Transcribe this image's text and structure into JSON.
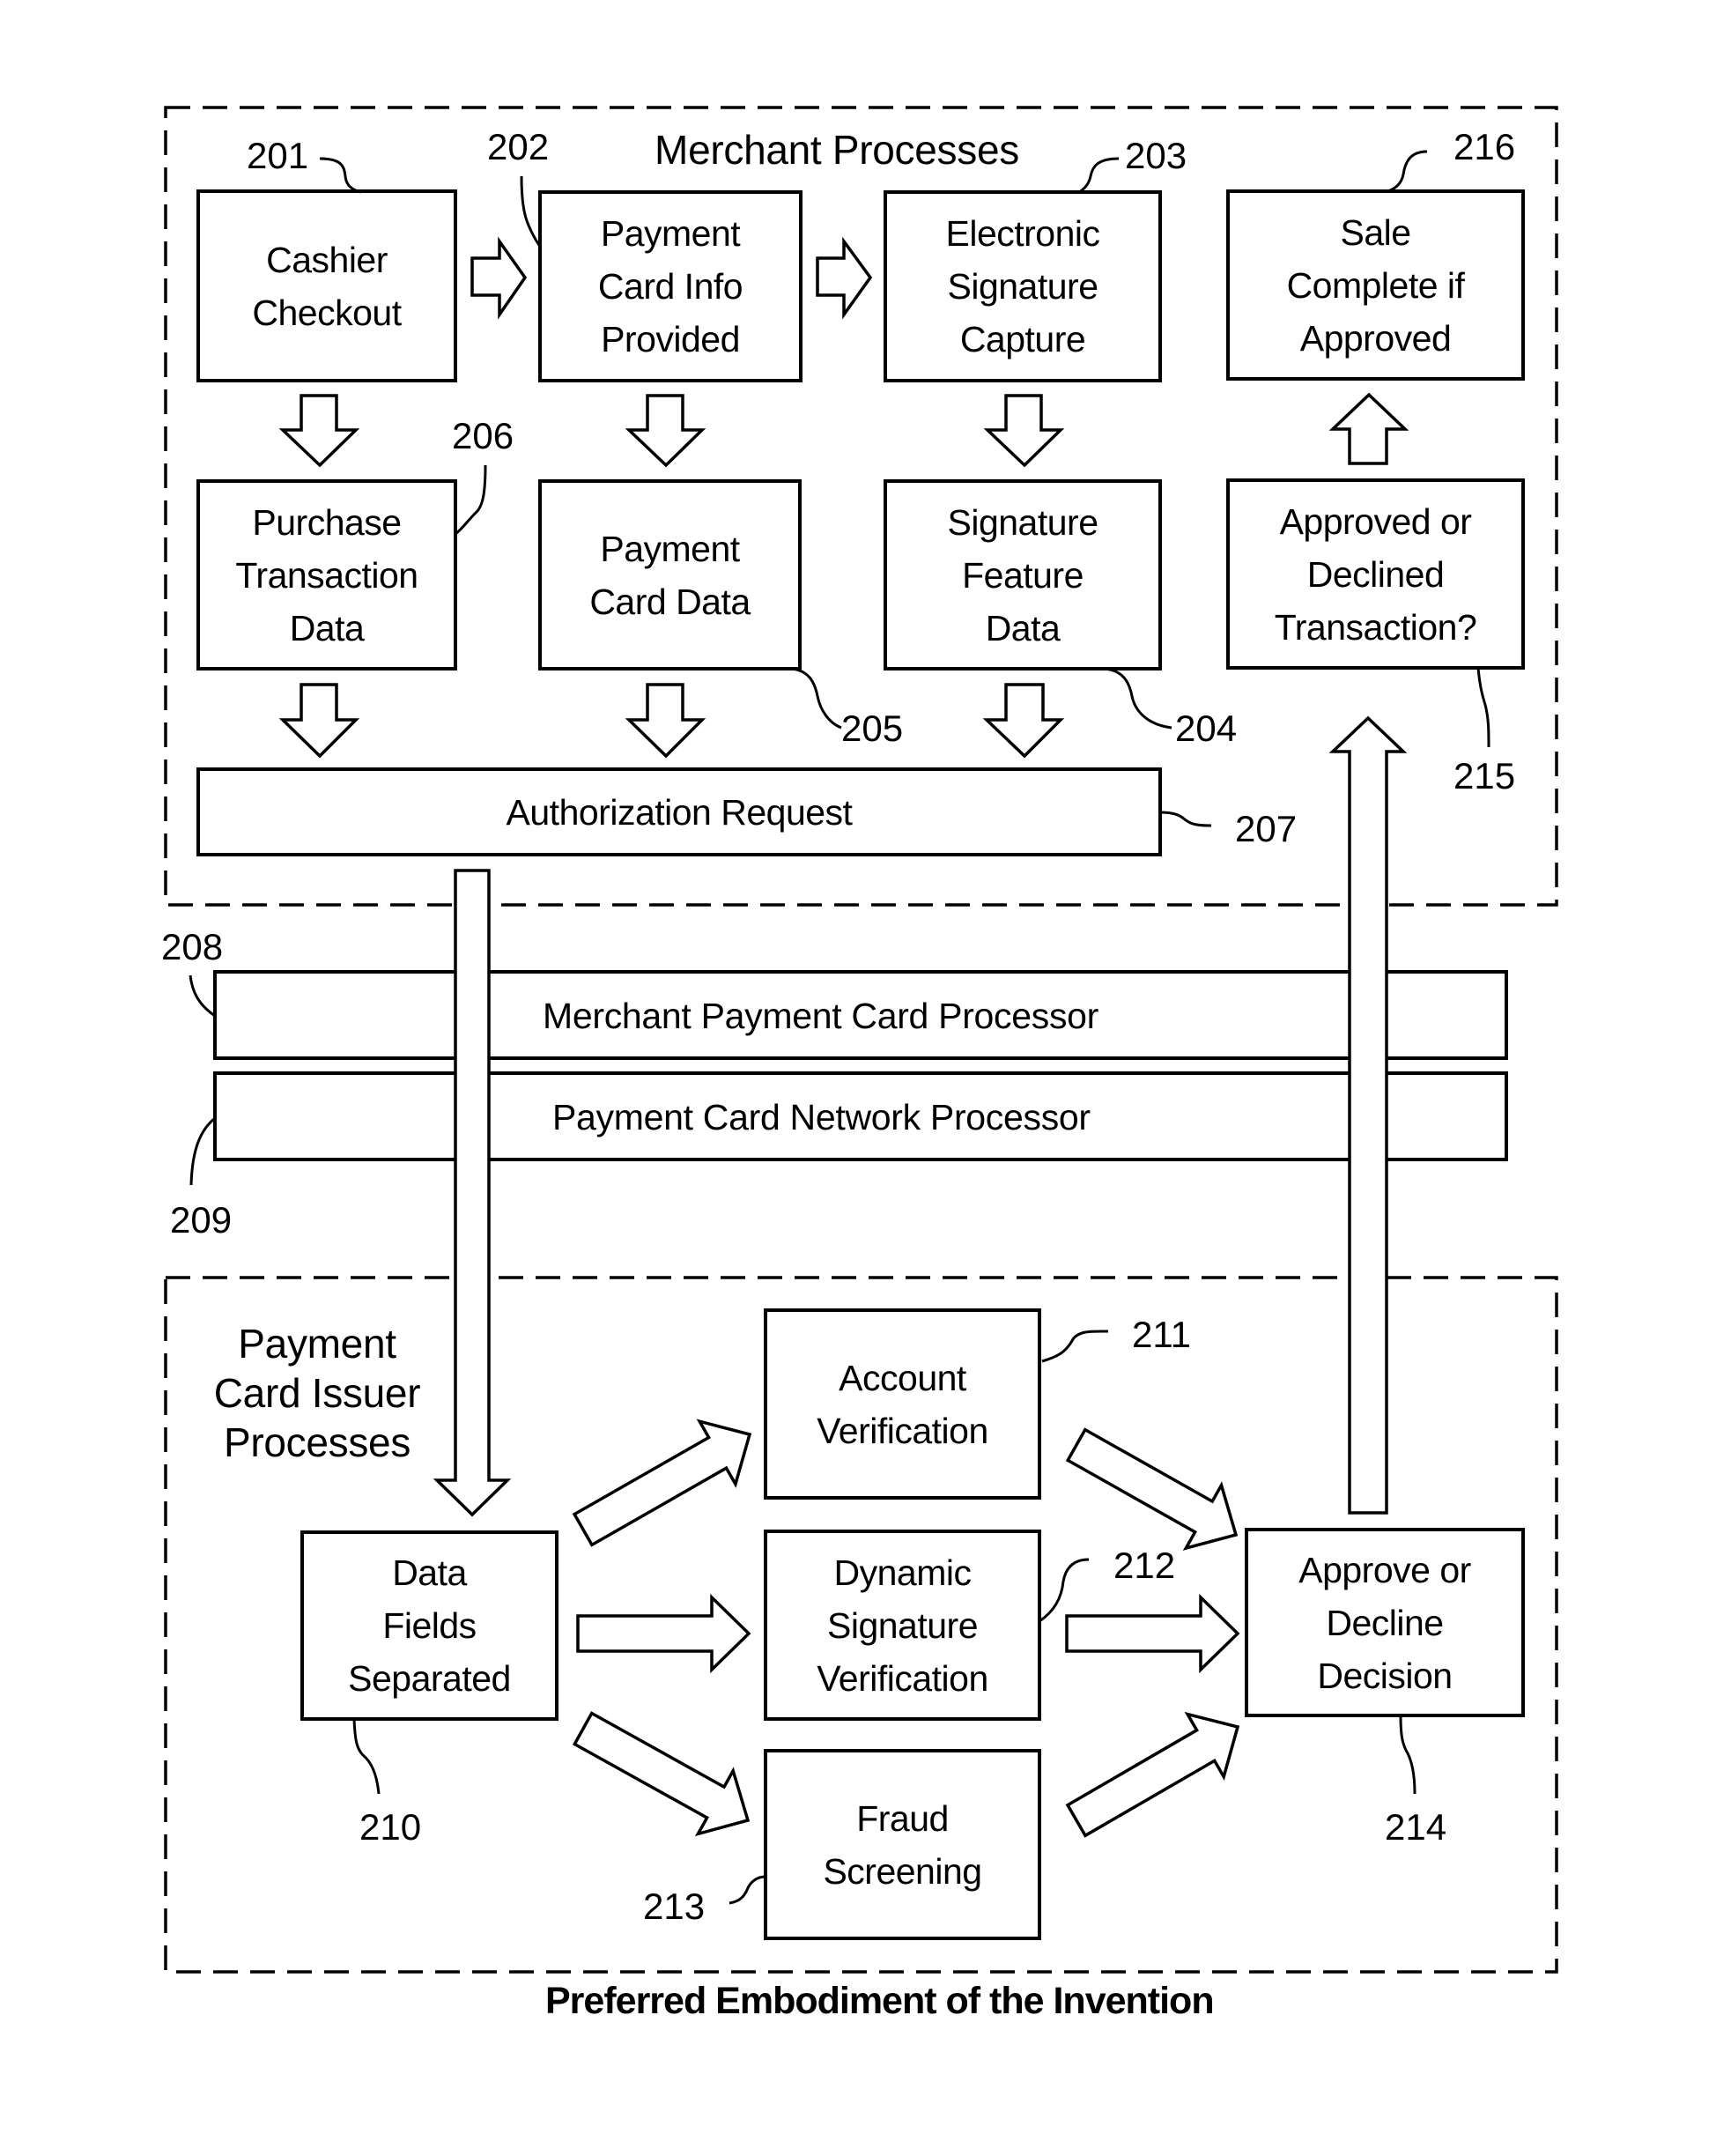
{
  "caption": "Preferred Embodiment of the Invention",
  "colors": {
    "stroke": "#000000",
    "background": "#ffffff"
  },
  "merchant_section": {
    "title": "Merchant Processes",
    "boxes": {
      "b201": {
        "ref": "201",
        "lines": [
          "Cashier",
          "Checkout"
        ]
      },
      "b202": {
        "ref": "202",
        "lines": [
          "Payment",
          "Card Info",
          "Provided"
        ]
      },
      "b203": {
        "ref": "203",
        "lines": [
          "Electronic",
          "Signature",
          "Capture"
        ]
      },
      "b216": {
        "ref": "216",
        "lines": [
          "Sale",
          "Complete if",
          "Approved"
        ]
      },
      "b206": {
        "ref": "206",
        "lines": [
          "Purchase",
          "Transaction",
          "Data"
        ]
      },
      "b205": {
        "ref": "205",
        "lines": [
          "Payment",
          "Card Data"
        ]
      },
      "b204": {
        "ref": "204",
        "lines": [
          "Signature",
          "Feature",
          "Data"
        ]
      },
      "b215": {
        "ref": "215",
        "lines": [
          "Approved or",
          "Declined",
          "Transaction?"
        ]
      },
      "b207": {
        "ref": "207",
        "lines": [
          "Authorization Request"
        ]
      }
    }
  },
  "processors": {
    "b208": {
      "ref": "208",
      "label": "Merchant Payment Card Processor"
    },
    "b209": {
      "ref": "209",
      "label": "Payment Card Network Processor"
    }
  },
  "issuer_section": {
    "title_lines": [
      "Payment",
      "Card Issuer",
      "Processes"
    ],
    "boxes": {
      "b210": {
        "ref": "210",
        "lines": [
          "Data",
          "Fields",
          "Separated"
        ]
      },
      "b211": {
        "ref": "211",
        "lines": [
          "Account",
          "Verification"
        ]
      },
      "b212": {
        "ref": "212",
        "lines": [
          "Dynamic",
          "Signature",
          "Verification"
        ]
      },
      "b213": {
        "ref": "213",
        "lines": [
          "Fraud",
          "Screening"
        ]
      },
      "b214": {
        "ref": "214",
        "lines": [
          "Approve or",
          "Decline",
          "Decision"
        ]
      }
    }
  },
  "flows": [
    {
      "from": "201",
      "to": "202"
    },
    {
      "from": "202",
      "to": "203"
    },
    {
      "from": "201",
      "to": "206"
    },
    {
      "from": "202",
      "to": "205"
    },
    {
      "from": "203",
      "to": "204"
    },
    {
      "from": "206",
      "to": "207"
    },
    {
      "from": "205",
      "to": "207"
    },
    {
      "from": "204",
      "to": "207"
    },
    {
      "from": "207",
      "to": "210",
      "via": [
        "208",
        "209"
      ]
    },
    {
      "from": "210",
      "to": "211"
    },
    {
      "from": "210",
      "to": "212"
    },
    {
      "from": "210",
      "to": "213"
    },
    {
      "from": "211",
      "to": "214"
    },
    {
      "from": "212",
      "to": "214"
    },
    {
      "from": "213",
      "to": "214"
    },
    {
      "from": "214",
      "to": "215",
      "via": [
        "209",
        "208"
      ]
    },
    {
      "from": "215",
      "to": "216"
    }
  ]
}
